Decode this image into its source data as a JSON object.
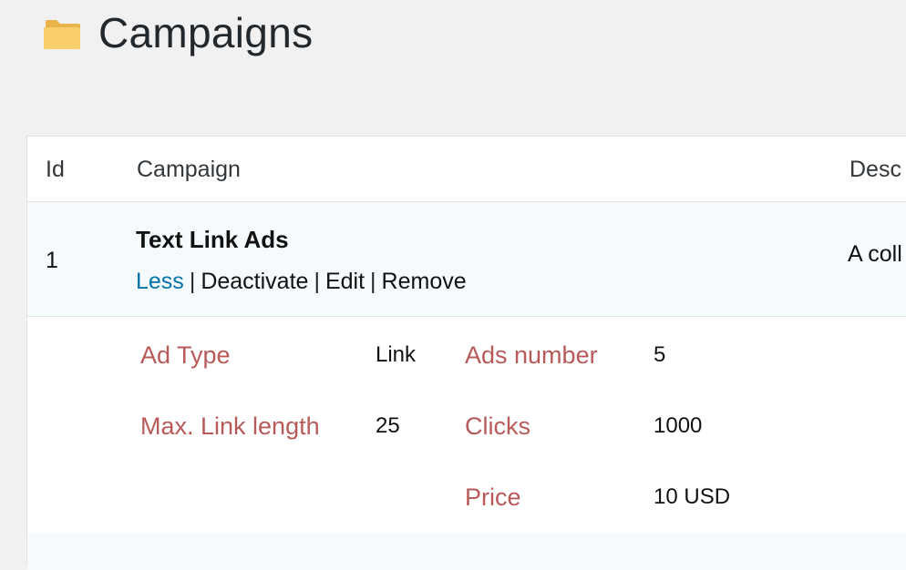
{
  "page": {
    "title": "Campaigns",
    "icon": "folder-icon"
  },
  "table": {
    "columns": {
      "id": "Id",
      "campaign": "Campaign",
      "description": "Desc"
    },
    "rows": [
      {
        "id": "1",
        "title": "Text Link Ads",
        "actions": {
          "less": "Less",
          "deactivate": "Deactivate",
          "edit": "Edit",
          "remove": "Remove",
          "separator": "|"
        },
        "description": "A coll"
      }
    ]
  },
  "details": {
    "ad_type_label": "Ad Type",
    "ad_type_value": "Link",
    "max_link_length_label": "Max. Link length",
    "max_link_length_value": "25",
    "ads_number_label": "Ads number",
    "ads_number_value": "5",
    "clicks_label": "Clicks",
    "clicks_value": "1000",
    "price_label": "Price",
    "price_value": "10 USD"
  },
  "colors": {
    "link": "#0073aa",
    "detail_label": "#b85a5a",
    "row_highlight": "#f5fafd",
    "folder": "#f7c85f"
  }
}
